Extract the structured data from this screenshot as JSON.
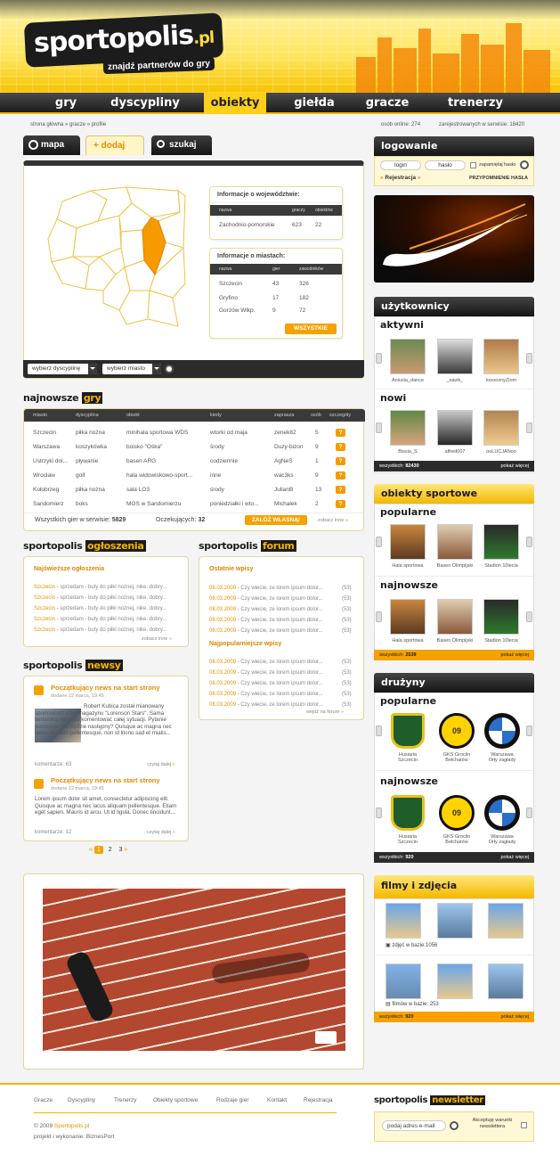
{
  "header": {
    "logo_main": "sportopolis",
    "logo_tld": ".pl",
    "slogan": "znajdź partnerów do gry"
  },
  "nav": [
    {
      "label": "gry"
    },
    {
      "label": "dyscypliny"
    },
    {
      "label": "obiekty",
      "active": true
    },
    {
      "label": "giełda"
    },
    {
      "label": "gracze"
    },
    {
      "label": "trenerzy"
    }
  ],
  "breadcrumb": "strona główna  »  gracze  »  profile",
  "stats": {
    "online": "osób online: 274",
    "registered": "zarejestrowanych w serwisie: 18420"
  },
  "tabs": {
    "map": "mapa",
    "add": "+ dodaj",
    "search": "szukaj"
  },
  "voivodeship": {
    "title": "Informacje o województwie:",
    "cols": [
      "nazwa",
      "graczy",
      "obiektów"
    ],
    "rows": [
      [
        "Zachodnio-pomorskie",
        "623",
        "22"
      ]
    ]
  },
  "cities": {
    "title": "Informacje o miastach:",
    "cols": [
      "nazwa",
      "gier",
      "zawodników"
    ],
    "rows": [
      [
        "Szczecin",
        "43",
        "326"
      ],
      [
        "Gryfino",
        "17",
        "182"
      ],
      [
        "Gorzów Wlkp.",
        "9",
        "72"
      ]
    ],
    "button": "WSZYSTKIE"
  },
  "filters": {
    "discipline": "wybierz dyscyplinę",
    "city": "wybierz miasto"
  },
  "games": {
    "title_a": "najnowsze",
    "title_b": "gry",
    "cols": [
      "miasto",
      "dyscyplina",
      "obiekt",
      "kiedy",
      "zapraszа",
      "osób",
      "szczegóły"
    ],
    "rows": [
      [
        "Szczecin",
        "piłka nożna",
        "minihala sportowa WDS",
        "wtorki od maja",
        "zenek82",
        "5",
        "?"
      ],
      [
        "Warszawa",
        "koszykówka",
        "boisko \"Ośka\"",
        "środy",
        "Duzy-bizon",
        "9",
        "?"
      ],
      [
        "Ustrzyki dol...",
        "pływanie",
        "basen ARG",
        "codziennie",
        "AgNeS",
        "1",
        "?"
      ],
      [
        "Wrocław",
        "golf",
        "hala widowiskowo-sport...",
        "inne",
        "wac3ks",
        "9",
        "?"
      ],
      [
        "Kołobrzeg",
        "piłka nożna",
        "sala LO3",
        "środy",
        "JulianB",
        "13",
        "?"
      ],
      [
        "Sandomierz",
        "boks",
        "MOS w Sandomierzu",
        "poniedziałki i wto...",
        "Michalek",
        "2",
        "?"
      ]
    ],
    "total_label": "Wszystkich gier w serwisie:",
    "total": "5829",
    "waiting_label": "Oczekujących:",
    "waiting": "32",
    "add_button": "ZAŁÓŻ WŁASNĄ!",
    "more": "zobacz inne"
  },
  "ads": {
    "title_a": "sportopolis",
    "title_b": "ogłoszenia",
    "heading": "Najświeższe ogłoszenia",
    "items": [
      {
        "city": "Szczecin",
        "text": " - sprzedam - buty do piłki nożnej, nike. dobry..."
      },
      {
        "city": "Szczecin",
        "text": " - sprzedam - buty do piłki nożnej, nike. dobry..."
      },
      {
        "city": "Szczecin",
        "text": " - sprzedam - buty do piłki nożnej, nike. dobry..."
      },
      {
        "city": "Szczecin",
        "text": " - sprzedam - buty do piłki nożnej, nike. dobry..."
      },
      {
        "city": "Szczecin",
        "text": " - sprzedam - buty do piłki nożnej, nike. dobry..."
      }
    ],
    "more": "zobacz inne"
  },
  "forum": {
    "title_a": "sportopolis",
    "title_b": "forum",
    "latest_heading": "Ostatnie wpisy",
    "popular_heading": "Najpopularniejsze wpisy",
    "latest": [
      {
        "date": "08.03.2009",
        "text": " - Czy wiecie, ze lorem ipsum dolor...",
        "count": "(53)"
      },
      {
        "date": "08.03.2009",
        "text": " - Czy wiecie, ze lorem ipsum dolor...",
        "count": "(53)"
      },
      {
        "date": "08.03.2009",
        "text": " - Czy wiecie, ze lorem ipsum dolor...",
        "count": "(53)"
      },
      {
        "date": "08.03.2009",
        "text": " - Czy wiecie, ze lorem ipsum dolor...",
        "count": "(53)"
      },
      {
        "date": "08.03.2009",
        "text": " - Czy wiecie, ze lorem ipsum dolor...",
        "count": "(53)"
      }
    ],
    "popular": [
      {
        "date": "08.03.2009",
        "text": " - Czy wiecie, ze lorem ipsum dolor...",
        "count": "(53)"
      },
      {
        "date": "08.03.2009",
        "text": " - Czy wiecie, ze lorem ipsum dolor...",
        "count": "(53)"
      },
      {
        "date": "08.03.2009",
        "text": " - Czy wiecie, ze lorem ipsum dolor...",
        "count": "(53)"
      },
      {
        "date": "08.03.2009",
        "text": " - Czy wiecie, ze lorem ipsum dolor...",
        "count": "(53)"
      },
      {
        "date": "08.03.2009",
        "text": " - Czy wiecie, ze lorem ipsum dolor...",
        "count": "(53)"
      }
    ],
    "more": "wejdź na forum"
  },
  "news": {
    "title_a": "sportopolis",
    "title_b": "newsy",
    "items": [
      {
        "title": "Początkujący news na start strony",
        "date": "dodane 22 marca, 19:45",
        "body": "Robert Kubica został mianowany sportowcem roku magazynu \"Lorenson Stars\". Sama tenisistka nie chce komentować całej sytuacji. Pytanie pozostaje: kto będzie następny? Quisque ac magna nec lacus aliquam pellentesque, non id litono sad et mialis...",
        "comments": "komentarze: 63",
        "more": "czytaj dalej"
      },
      {
        "title": "Początkujący news na start strony",
        "date": "dodane 22 marca, 19:45",
        "body": "Lorem ipsum dolor sit amet, consectetur adipiscing elit. Quisque ac magna nec lacus aliquam pellentesque. Etiam eget sapien. Mauris id arcu. Ut id ligula. Donec tincidunt...",
        "comments": "komentarze: 12",
        "more": "czytaj dalej"
      }
    ],
    "pages": [
      "1",
      "2",
      "3"
    ]
  },
  "login": {
    "title": "logowanie",
    "login": "login",
    "password": "hasło",
    "remember": "zapamiętaj hasło",
    "register": "Rejestracja",
    "forgot": "PRZYPOMNIENIE HASŁA"
  },
  "users": {
    "title": "użytkownicy",
    "active_title": "aktywni",
    "new_title": "nowi",
    "active": [
      "Aniusia_dance",
      "_savik_",
      "looooznyZiom"
    ],
    "new": [
      "Bissia_S",
      "alfred007",
      "ooLUCJANoo"
    ],
    "total_label": "wszystkich:",
    "total": "82430",
    "more": "pokaż więcej"
  },
  "objects": {
    "title": "obiekty sportowe",
    "popular_title": "popularne",
    "newest_title": "najnowsze",
    "popular": [
      "Hala sportowa",
      "Basen Olimpijski",
      "Stadion 10lecia"
    ],
    "newest": [
      "Hala sportowa",
      "Basen Olimpijski",
      "Stadion 10lecia"
    ],
    "total_label": "wszystkich:",
    "total": "2539",
    "more": "pokaż więcej"
  },
  "teams": {
    "title": "drużyny",
    "popular_title": "popularne",
    "newest_title": "najnowsze",
    "popular": [
      [
        "Husiaria",
        "Szczecin"
      ],
      [
        "GKS Groclin",
        "Bełchatów"
      ],
      [
        "Warszawa",
        "Orły zagłady"
      ]
    ],
    "newest": [
      [
        "Husiaria",
        "Szczecin"
      ],
      [
        "GKS Groclin",
        "Bełchatów"
      ],
      [
        "Warszawa",
        "Orły zagłady"
      ]
    ],
    "bvb": "09",
    "total_label": "wszystkich:",
    "total": "920",
    "more": "pokaż więcej"
  },
  "media": {
    "title": "filmy i zdjęcia",
    "photos_label": "zdjęć w bazie:1056",
    "films_label": "filmów w bazie: 253",
    "total_label": "wszystkich:",
    "total": "920",
    "more": "pokaż więcej"
  },
  "footer": {
    "links": [
      "Gracze",
      "Dyscypliny",
      "Trenerzy",
      "Obiekty sportowe",
      "Rodzaje gier",
      "Kontakt",
      "Rejestracja"
    ],
    "copyright": "© 2009 ",
    "site": "Sportopolis.pl",
    "credits": "projekt i wykonanie: BiznesPort"
  },
  "newsletter": {
    "title_a": "sportopolis",
    "title_b": "newsletter",
    "placeholder": "podaj adres e-mail",
    "accept": "Akceptuję warunki newslettera"
  },
  "colors": {
    "accent": "#f5a200",
    "dark": "#1c1c1c",
    "highlight_region": "#f79a00"
  }
}
